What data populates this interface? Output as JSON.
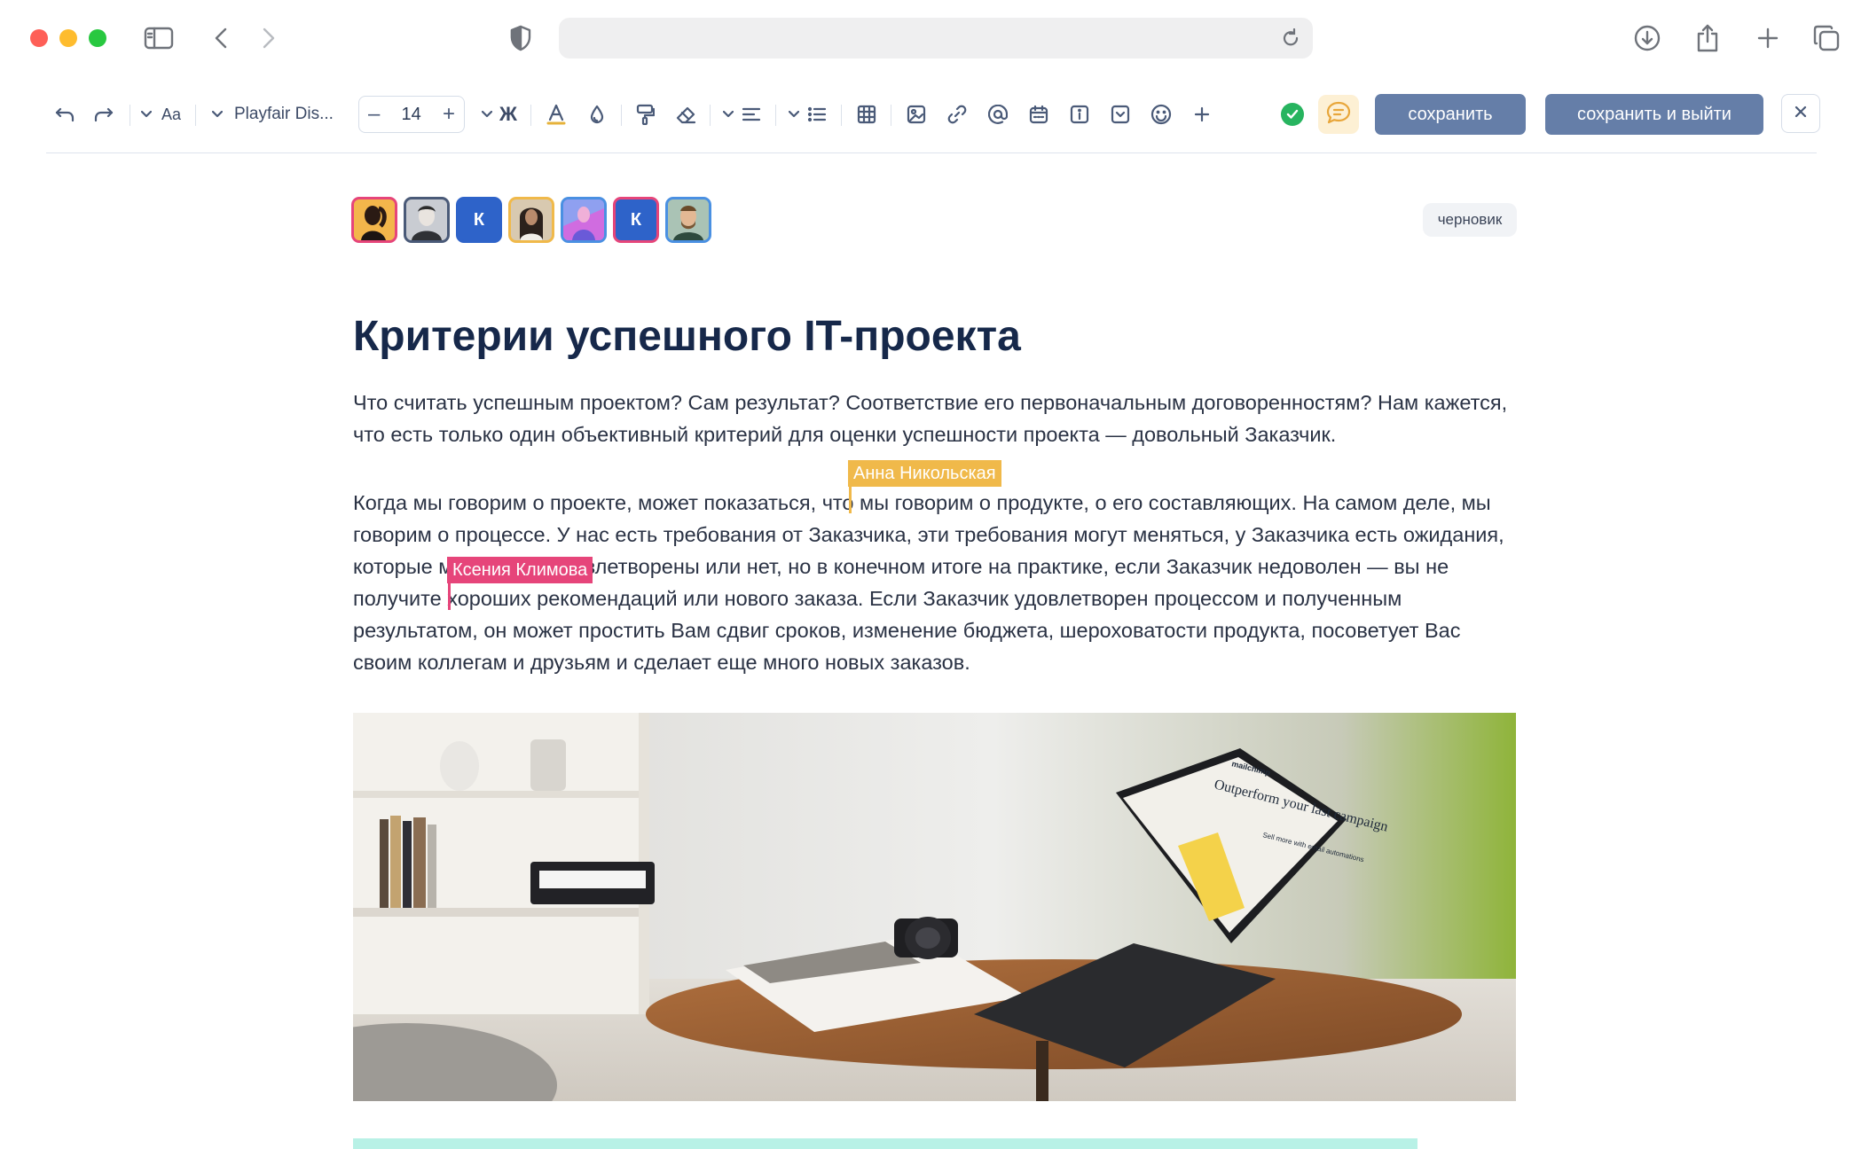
{
  "browser": {
    "address": "",
    "icons": [
      "sidebar-icon",
      "back-icon",
      "forward-icon",
      "shield-icon",
      "reload-icon",
      "download-icon",
      "share-icon",
      "new-tab-icon",
      "tabs-overview-icon"
    ]
  },
  "toolbar": {
    "font_name": "Playfair Dis...",
    "font_size": "14",
    "minus": "–",
    "plus": "+",
    "bold_glyph": "Ж",
    "text_style_glyph": "Aa",
    "save_label": "сохранить",
    "save_exit_label": "сохранить и выйти",
    "close_glyph": "×",
    "status_color": "#27b45f",
    "accent_color": "#657ea8"
  },
  "document": {
    "status_badge": "черновик",
    "collaborators": [
      {
        "initial": "",
        "border": "#e6457a",
        "bg": "#f3b64b"
      },
      {
        "initial": "",
        "border": "#4a5a78",
        "bg": "#c9ccd2"
      },
      {
        "initial": "К",
        "border": "#2e63c9",
        "bg": "#2e63c9"
      },
      {
        "initial": "",
        "border": "#f0b94a",
        "bg": "#d8c9b0"
      },
      {
        "initial": "",
        "border": "#4a90e2",
        "bg": "#c87fe0"
      },
      {
        "initial": "К",
        "border": "#e6457a",
        "bg": "#2e63c9"
      },
      {
        "initial": "",
        "border": "#4a90e2",
        "bg": "#9bb89a"
      }
    ],
    "title": "Критерии успешного IT-проекта",
    "paragraph1": "Что считать успешным проектом? Сам результат? Соответствие его первоначальным договоренностям? Нам кажется, что есть только один объективный критерий для оценки успешности проекта — довольный Заказчик.",
    "paragraph2": "Когда мы говорим о проекте, может показаться, что мы говорим о продукте, о его составляющих. На самом деле, мы говорим о процессе. У нас есть требования от Заказчика, эти требования могут меняться, у Заказчика есть ожидания, которые могут быть удовлетворены или нет, но в конечном итоге на практике, если Заказчик недоволен — вы не получите хороших рекомендаций или нового заказа. Если Заказчик удовлетворен процессом и полученным результатом, он может простить Вам сдвиг сроков, изменение бюджета, шероховатости продукта, посоветует Вас своим коллегам и друзьям и сделает еще много новых заказов.",
    "cursors": [
      {
        "name": "Анна Никольская",
        "color": "#f0b94a"
      },
      {
        "name": "Ксения Климова",
        "color": "#e6457a"
      }
    ],
    "image": {
      "screen_logo": "mailchimp",
      "screen_headline": "Outperform your last campaign",
      "screen_sub": "Sell more with email automations"
    }
  }
}
